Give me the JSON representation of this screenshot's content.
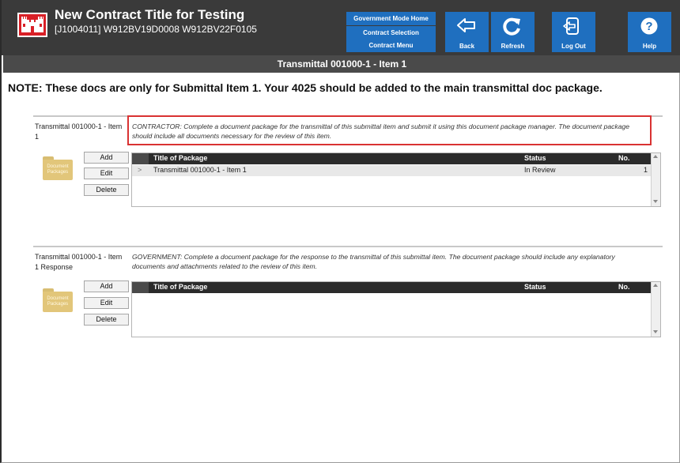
{
  "header": {
    "title": "New Contract Title for Testing",
    "subtitle": "[J1004011] W912BV19D0008  W912BV22F0105",
    "nav_links": [
      "Government Mode Home",
      "Contract Selection",
      "Contract Menu"
    ],
    "buttons": [
      {
        "label": "Back",
        "icon": "back-arrow-icon"
      },
      {
        "label": "Refresh",
        "icon": "refresh-icon"
      },
      {
        "label": "Log Out",
        "icon": "logout-icon"
      },
      {
        "label": "Help",
        "icon": "help-icon"
      }
    ],
    "colors": {
      "header_bg": "#3a3a3a",
      "button_blue": "#1f6fbf",
      "logo_red": "#d91f26"
    }
  },
  "band_title": "Transmittal 001000-1 - Item 1",
  "note": "NOTE: These docs are only for Submittal Item 1. Your 4025 should be added to the main transmittal doc package.",
  "sections": [
    {
      "label": "Transmittal 001000-1 - Item 1",
      "description": "CONTRACTOR: Complete a document package for the transmittal of this submittal item and submit it using this document package manager. The document package should include all documents necessary for the review of this item.",
      "folder_label": "Document Packages",
      "actions": [
        "Add",
        "Edit",
        "Delete"
      ],
      "columns": [
        "Title of Package",
        "Status",
        "No."
      ],
      "rows": [
        {
          "title": "Transmittal 001000-1 - Item 1",
          "status": "In Review",
          "no": "1"
        }
      ]
    },
    {
      "label": "Transmittal 001000-1 - Item 1 Response",
      "description": "GOVERNMENT: Complete a document package for the response to the transmittal of this submittal item. The document package should include any explanatory documents and attachments related to the review of this item.",
      "folder_label": "Document Packages",
      "actions": [
        "Add",
        "Edit",
        "Delete"
      ],
      "columns": [
        "Title of Package",
        "Status",
        "No."
      ],
      "rows": []
    }
  ]
}
